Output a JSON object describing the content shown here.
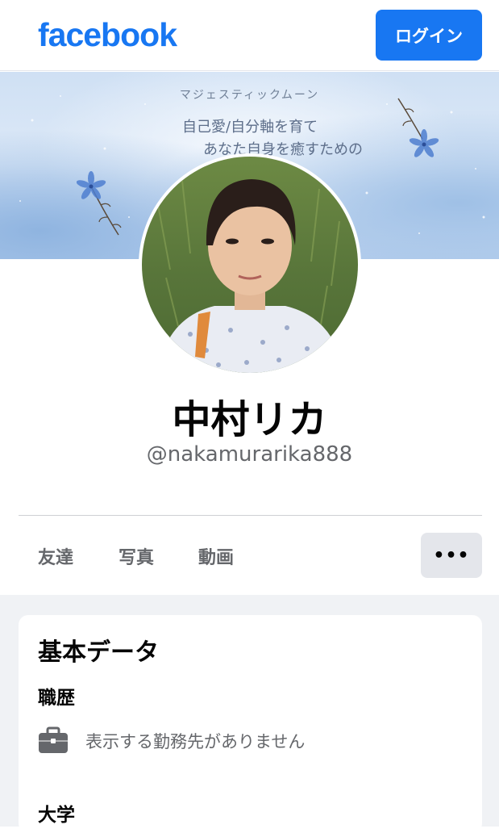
{
  "header": {
    "logo": "facebook",
    "login_label": "ログイン",
    "brand_color": "#1877f2"
  },
  "cover": {
    "subtitle": "マジェスティックムーン",
    "line1": "自己愛/自分軸を育て",
    "line2": "あなた自身を癒すための"
  },
  "profile": {
    "name": "中村リカ",
    "handle": "@nakamurarika888"
  },
  "tabs": [
    "友達",
    "写真",
    "動画"
  ],
  "more_label": "•••",
  "about": {
    "title": "基本データ",
    "work_heading": "職歴",
    "work_empty": "表示する勤務先がありません",
    "work_icon": "briefcase-icon",
    "education_heading": "大学"
  }
}
